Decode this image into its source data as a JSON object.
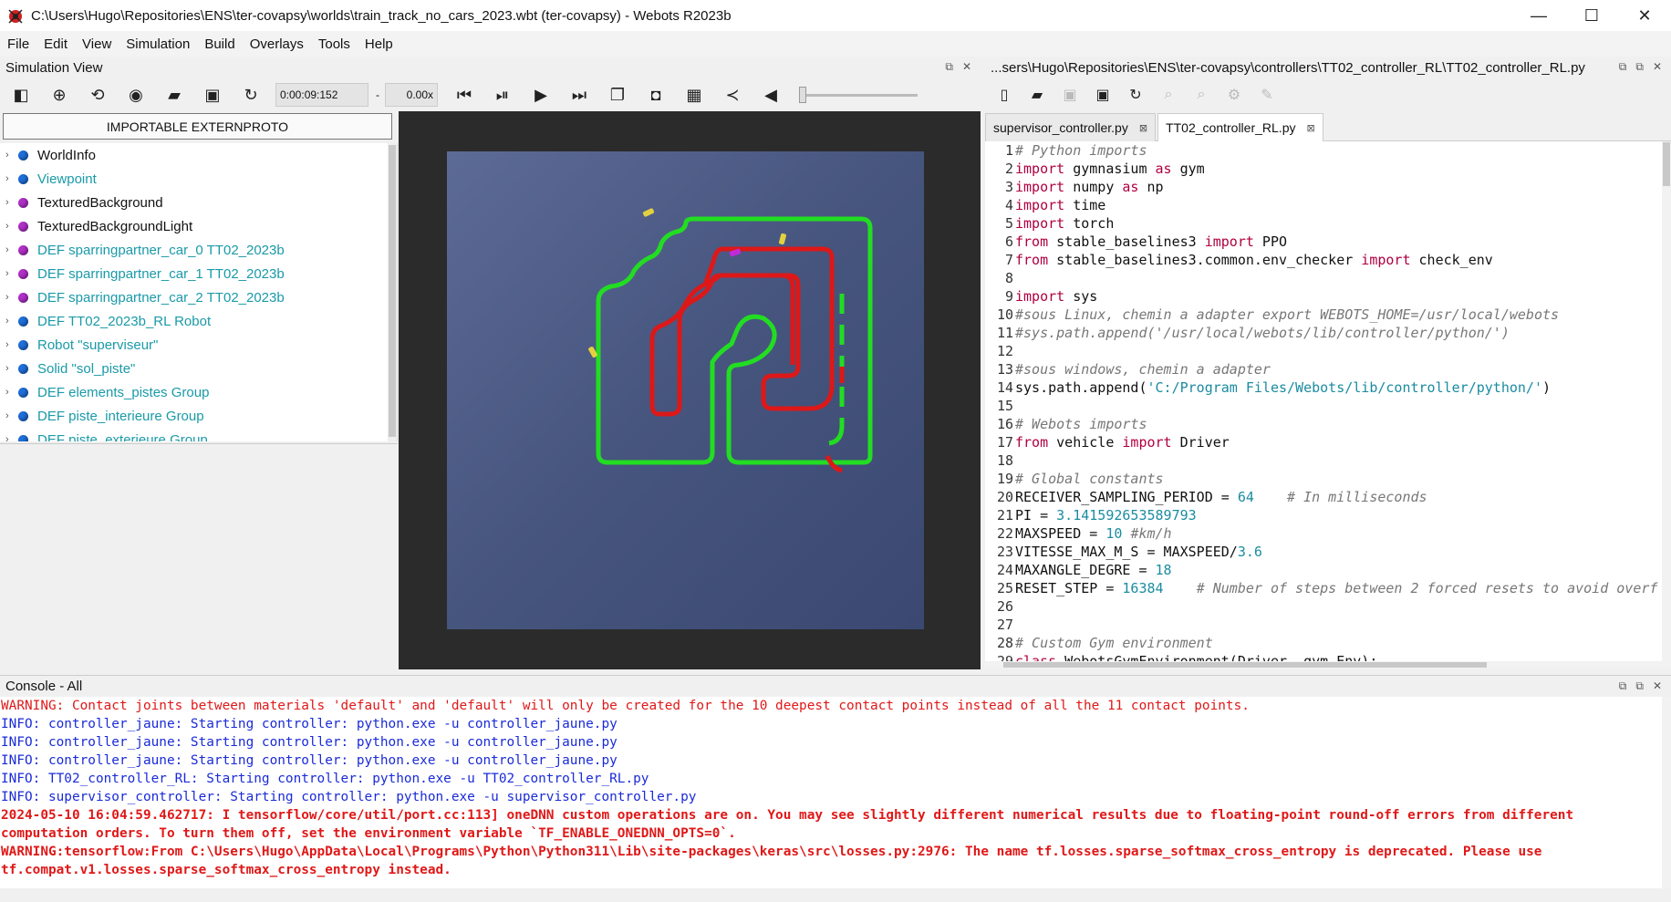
{
  "window": {
    "title": "C:\\Users\\Hugo\\Repositories\\ENS\\ter-covapsy\\worlds\\train_track_no_cars_2023.wbt (ter-covapsy) - Webots R2023b",
    "minimize": "—",
    "maximize": "☐",
    "close": "✕"
  },
  "menu": [
    "File",
    "Edit",
    "View",
    "Simulation",
    "Build",
    "Overlays",
    "Tools",
    "Help"
  ],
  "simulation_view": {
    "title": "Simulation View",
    "time": "0:00:09:152",
    "time_sep": "-",
    "speed": "0.00x",
    "extern_button": "IMPORTABLE EXTERNPROTO"
  },
  "scene_tree": [
    {
      "label": "WorldInfo",
      "dot": "#1e6fd9",
      "color": "#111111"
    },
    {
      "label": "Viewpoint",
      "dot": "#1e6fd9",
      "color": "#1a9aa8"
    },
    {
      "label": "TexturedBackground",
      "dot": "#b030c8",
      "color": "#111111"
    },
    {
      "label": "TexturedBackgroundLight",
      "dot": "#b030c8",
      "color": "#111111"
    },
    {
      "label": "DEF sparringpartner_car_0 TT02_2023b",
      "dot": "#b030c8",
      "color": "#1a9aa8"
    },
    {
      "label": "DEF sparringpartner_car_1 TT02_2023b",
      "dot": "#b030c8",
      "color": "#1a9aa8"
    },
    {
      "label": "DEF sparringpartner_car_2 TT02_2023b",
      "dot": "#b030c8",
      "color": "#1a9aa8"
    },
    {
      "label": "DEF TT02_2023b_RL Robot",
      "dot": "#1e6fd9",
      "color": "#1a9aa8"
    },
    {
      "label": "Robot \"superviseur\"",
      "dot": "#1e6fd9",
      "color": "#1a9aa8"
    },
    {
      "label": "Solid \"sol_piste\"",
      "dot": "#1e6fd9",
      "color": "#1a9aa8"
    },
    {
      "label": "DEF elements_pistes Group",
      "dot": "#1e6fd9",
      "color": "#1a9aa8"
    },
    {
      "label": "DEF piste_interieure Group",
      "dot": "#1e6fd9",
      "color": "#1a9aa8"
    },
    {
      "label": "DEF piste_exterieure Group",
      "dot": "#1e6fd9",
      "color": "#1a9aa8"
    }
  ],
  "editor": {
    "path": "...sers\\Hugo\\Repositories\\ENS\\ter-covapsy\\controllers\\TT02_controller_RL\\TT02_controller_RL.py",
    "tabs": [
      {
        "label": "supervisor_controller.py",
        "active": false
      },
      {
        "label": "TT02_controller_RL.py",
        "active": true
      }
    ],
    "lines": [
      {
        "n": "1",
        "parts": [
          [
            "cm",
            "# Python imports"
          ]
        ]
      },
      {
        "n": "2",
        "parts": [
          [
            "kw",
            "import"
          ],
          [
            "",
            " gymnasium "
          ],
          [
            "kw",
            "as"
          ],
          [
            "",
            " gym"
          ]
        ]
      },
      {
        "n": "3",
        "parts": [
          [
            "kw",
            "import"
          ],
          [
            "",
            " numpy "
          ],
          [
            "kw",
            "as"
          ],
          [
            "",
            " np"
          ]
        ]
      },
      {
        "n": "4",
        "parts": [
          [
            "kw",
            "import"
          ],
          [
            "",
            " time"
          ]
        ]
      },
      {
        "n": "5",
        "parts": [
          [
            "kw",
            "import"
          ],
          [
            "",
            " torch"
          ]
        ]
      },
      {
        "n": "6",
        "parts": [
          [
            "kw",
            "from"
          ],
          [
            "",
            " stable_baselines3 "
          ],
          [
            "kw",
            "import"
          ],
          [
            "",
            " PPO"
          ]
        ]
      },
      {
        "n": "7",
        "parts": [
          [
            "kw",
            "from"
          ],
          [
            "",
            " stable_baselines3.common.env_checker "
          ],
          [
            "kw",
            "import"
          ],
          [
            "",
            " check_env"
          ]
        ]
      },
      {
        "n": "8",
        "parts": []
      },
      {
        "n": "9",
        "parts": [
          [
            "kw",
            "import"
          ],
          [
            "",
            " sys"
          ]
        ]
      },
      {
        "n": "10",
        "parts": [
          [
            "cm",
            "#sous Linux, chemin a adapter export WEBOTS_HOME=/usr/local/webots"
          ]
        ]
      },
      {
        "n": "11",
        "parts": [
          [
            "cm",
            "#sys.path.append('/usr/local/webots/lib/controller/python/')"
          ]
        ]
      },
      {
        "n": "12",
        "parts": []
      },
      {
        "n": "13",
        "parts": [
          [
            "cm",
            "#sous windows, chemin a adapter"
          ]
        ]
      },
      {
        "n": "14",
        "parts": [
          [
            "",
            "sys.path.append("
          ],
          [
            "st",
            "'C:/Program Files/Webots/lib/controller/python/'"
          ],
          [
            "",
            ")"
          ]
        ]
      },
      {
        "n": "15",
        "parts": []
      },
      {
        "n": "16",
        "parts": [
          [
            "cm",
            "# Webots imports"
          ]
        ]
      },
      {
        "n": "17",
        "parts": [
          [
            "kw",
            "from"
          ],
          [
            "",
            " vehicle "
          ],
          [
            "kw",
            "import"
          ],
          [
            "",
            " Driver"
          ]
        ]
      },
      {
        "n": "18",
        "parts": []
      },
      {
        "n": "19",
        "parts": [
          [
            "cm",
            "# Global constants"
          ]
        ]
      },
      {
        "n": "20",
        "parts": [
          [
            "",
            "RECEIVER_SAMPLING_PERIOD = "
          ],
          [
            "nm",
            "64"
          ],
          [
            "",
            "    "
          ],
          [
            "cm",
            "# In milliseconds"
          ]
        ]
      },
      {
        "n": "21",
        "parts": [
          [
            "",
            "PI = "
          ],
          [
            "nm",
            "3.141592653589793"
          ]
        ]
      },
      {
        "n": "22",
        "parts": [
          [
            "",
            "MAXSPEED = "
          ],
          [
            "nm",
            "10"
          ],
          [
            "",
            " "
          ],
          [
            "cm",
            "#km/h"
          ]
        ]
      },
      {
        "n": "23",
        "parts": [
          [
            "",
            "VITESSE_MAX_M_S = MAXSPEED/"
          ],
          [
            "nm",
            "3.6"
          ]
        ]
      },
      {
        "n": "24",
        "parts": [
          [
            "",
            "MAXANGLE_DEGRE = "
          ],
          [
            "nm",
            "18"
          ]
        ]
      },
      {
        "n": "25",
        "parts": [
          [
            "",
            "RESET_STEP = "
          ],
          [
            "nm",
            "16384"
          ],
          [
            "",
            "    "
          ],
          [
            "cm",
            "# Number of steps between 2 forced resets to avoid overf"
          ]
        ]
      },
      {
        "n": "26",
        "parts": []
      },
      {
        "n": "27",
        "parts": []
      },
      {
        "n": "28",
        "parts": [
          [
            "cm",
            "# Custom Gym environment"
          ]
        ]
      },
      {
        "n": "29",
        "parts": [
          [
            "kw",
            "class"
          ],
          [
            "",
            " WebotsGymEnvironment(Driver, gym.Env):"
          ]
        ]
      }
    ]
  },
  "console": {
    "title": "Console - All",
    "lines": [
      {
        "cls": "c-warn",
        "text": "WARNING: Contact joints between materials 'default' and 'default' will only be created for the 10 deepest contact points instead of all the 11 contact points."
      },
      {
        "cls": "c-info",
        "text": "INFO: controller_jaune: Starting controller: python.exe -u controller_jaune.py"
      },
      {
        "cls": "c-info",
        "text": "INFO: controller_jaune: Starting controller: python.exe -u controller_jaune.py"
      },
      {
        "cls": "c-info",
        "text": "INFO: controller_jaune: Starting controller: python.exe -u controller_jaune.py"
      },
      {
        "cls": "c-info",
        "text": "INFO: TT02_controller_RL: Starting controller: python.exe -u TT02_controller_RL.py"
      },
      {
        "cls": "c-info",
        "text": "INFO: supervisor_controller: Starting controller: python.exe -u supervisor_controller.py"
      },
      {
        "cls": "c-err",
        "text": "2024-05-10 16:04:59.462717: I tensorflow/core/util/port.cc:113] oneDNN custom operations are on. You may see slightly different numerical results due to floating-point round-off errors from different"
      },
      {
        "cls": "c-err",
        "text": "computation orders. To turn them off, set the environment variable `TF_ENABLE_ONEDNN_OPTS=0`."
      },
      {
        "cls": "c-err",
        "text": "WARNING:tensorflow:From C:\\Users\\Hugo\\AppData\\Local\\Programs\\Python\\Python311\\Lib\\site-packages\\keras\\src\\losses.py:2976: The name tf.losses.sparse_softmax_cross_entropy is deprecated. Please use"
      },
      {
        "cls": "c-err",
        "text": "tf.compat.v1.losses.sparse_softmax_cross_entropy instead."
      }
    ]
  }
}
